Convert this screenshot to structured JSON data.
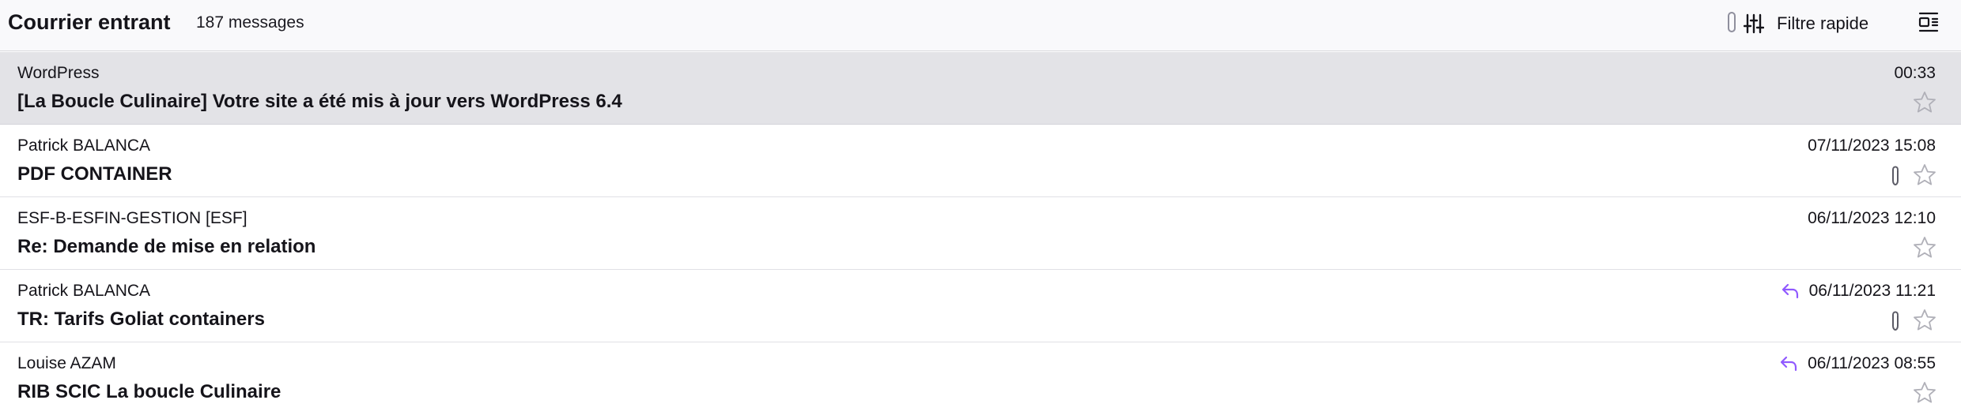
{
  "header": {
    "folder_name": "Courrier entrant",
    "message_count": "187 messages",
    "quick_filter_label": "Filtre rapide",
    "quick_filter_icon": "sliders-icon",
    "view_options_icon": "list-layout-icon"
  },
  "colors": {
    "selected_row": "#e3e3e7",
    "reply_accent": "#9059ff",
    "star_outline": "#b0b0b8"
  },
  "messages": [
    {
      "sender": "WordPress",
      "subject": "[La Boucle Culinaire] Votre site a été mis à jour vers WordPress 6.4",
      "date": "00:33",
      "replied": false,
      "attachment": false,
      "starred": false,
      "selected": true
    },
    {
      "sender": "Patrick BALANCA",
      "subject": "PDF CONTAINER",
      "date": "07/11/2023 15:08",
      "replied": false,
      "attachment": true,
      "starred": false,
      "selected": false
    },
    {
      "sender": "ESF-B-ESFIN-GESTION [ESF]",
      "subject": "Re: Demande de mise en relation",
      "date": "06/11/2023 12:10",
      "replied": false,
      "attachment": false,
      "starred": false,
      "selected": false
    },
    {
      "sender": "Patrick BALANCA",
      "subject": "TR: Tarifs Goliat containers",
      "date": "06/11/2023 11:21",
      "replied": true,
      "attachment": true,
      "starred": false,
      "selected": false
    },
    {
      "sender": "Louise AZAM",
      "subject": "RIB SCIC La boucle Culinaire",
      "date": "06/11/2023 08:55",
      "replied": true,
      "attachment": false,
      "starred": false,
      "selected": false
    }
  ]
}
